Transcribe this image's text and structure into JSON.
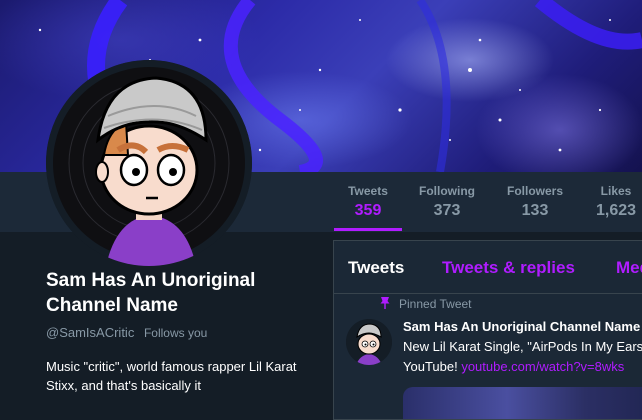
{
  "profile": {
    "name": "Sam Has An Unoriginal Channel Name",
    "handle": "@SamIsACritic",
    "follows_you": "Follows you",
    "bio": "Music \"critic\", world famous rapper Lil Karat Stixx, and that's basically it"
  },
  "stats": [
    {
      "label": "Tweets",
      "value": "359",
      "active": true
    },
    {
      "label": "Following",
      "value": "373",
      "active": false
    },
    {
      "label": "Followers",
      "value": "133",
      "active": false
    },
    {
      "label": "Likes",
      "value": "1,623",
      "active": false
    }
  ],
  "tabs": [
    {
      "label": "Tweets",
      "active": true
    },
    {
      "label": "Tweets & replies",
      "active": false
    },
    {
      "label": "Media",
      "active": false
    }
  ],
  "pinned": {
    "label": "Pinned Tweet",
    "author": "Sam Has An Unoriginal Channel Name",
    "text_line1": "New Lil Karat Single, \"AirPods In My Ears\"",
    "text_line2_prefix": "YouTube! ",
    "link": "youtube.com/watch?v=8wks"
  },
  "colors": {
    "accent": "#b01cff",
    "background": "#141d26",
    "panel": "#1b2836",
    "muted_text": "#8899a6"
  },
  "icons": {
    "pin": "pin-icon"
  }
}
